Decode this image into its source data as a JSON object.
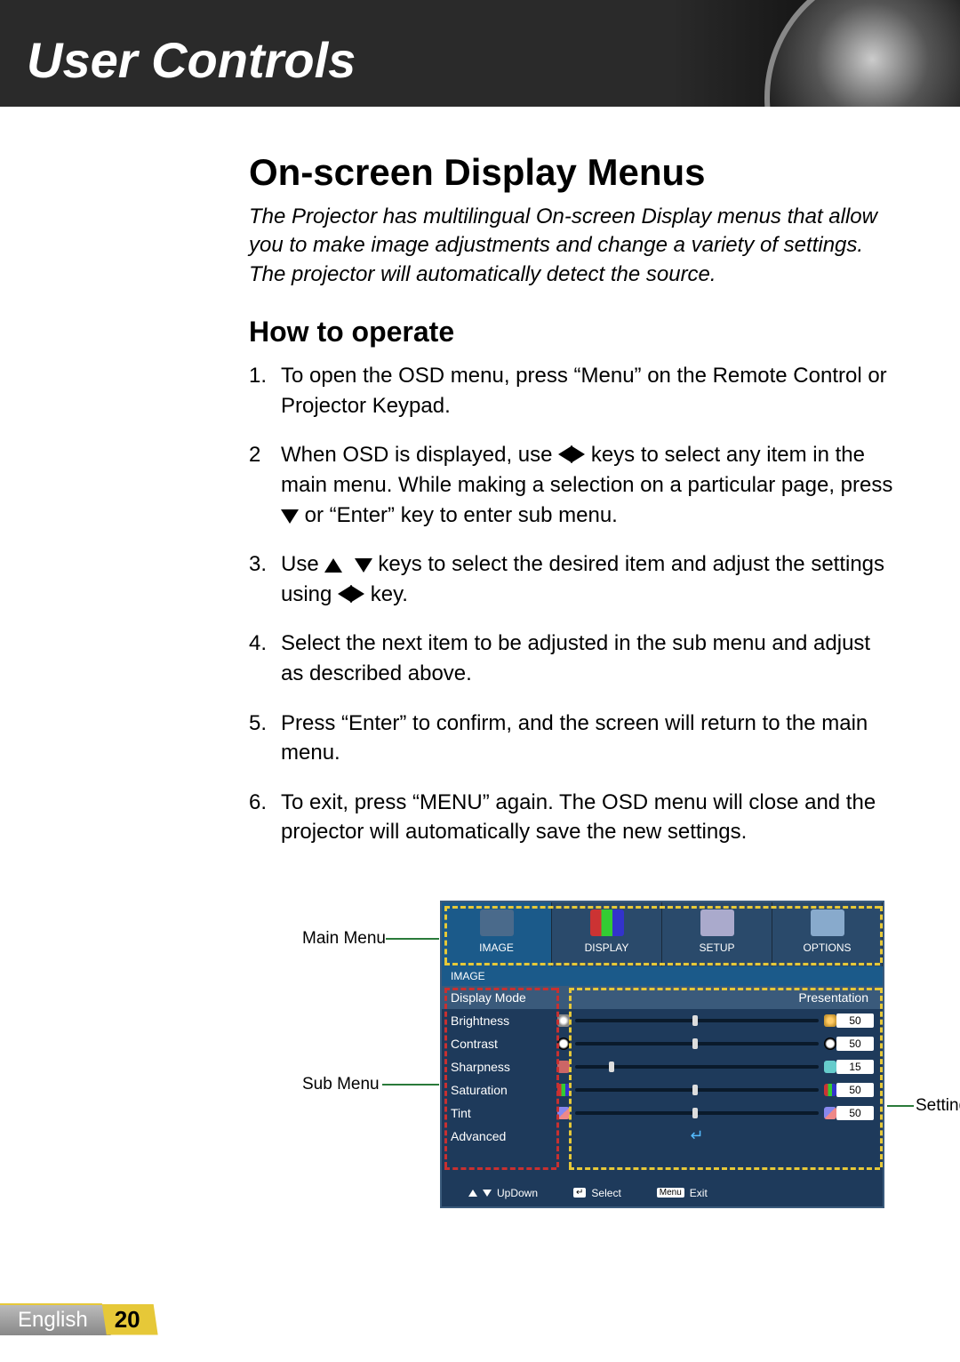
{
  "header": {
    "title": "User Controls"
  },
  "section": {
    "title": "On-screen Display Menus",
    "intro": "The Projector has multilingual On-screen Display menus that allow you to make image adjustments and change a variety of settings. The projector will automatically detect the source.",
    "subheading": "How to operate",
    "steps": {
      "s1": {
        "num": "1.",
        "text": "To open the OSD menu, press “Menu” on the Remote Control or Projector Keypad."
      },
      "s2": {
        "num": "2",
        "a": "When OSD is displayed, use ",
        "b": " keys to select any item in the main menu. While making a selection on a particular page, press ",
        "c": " or “Enter” key to enter sub menu."
      },
      "s3": {
        "num": "3.",
        "a": "Use ",
        "b": " keys to select the desired item and adjust the settings using ",
        "c": " key."
      },
      "s4": {
        "num": "4.",
        "text": "Select the next item to be adjusted in the sub menu and adjust as described above."
      },
      "s5": {
        "num": "5.",
        "text": "Press “Enter” to confirm, and the screen will return to the main menu."
      },
      "s6": {
        "num": "6.",
        "text": "To exit, press “MENU” again. The OSD menu will close and the projector will automatically save the new settings."
      }
    }
  },
  "figure": {
    "labels": {
      "main": "Main Menu",
      "sub": "Sub Menu",
      "settings": "Settings"
    },
    "tabs": [
      "IMAGE",
      "DISPLAY",
      "SETUP",
      "OPTIONS"
    ],
    "section_label": "IMAGE",
    "rows": {
      "display_mode": {
        "label": "Display Mode",
        "value": "Presentation"
      },
      "brightness": {
        "label": "Brightness",
        "value": "50"
      },
      "contrast": {
        "label": "Contrast",
        "value": "50"
      },
      "sharpness": {
        "label": "Sharpness",
        "value": "15"
      },
      "saturation": {
        "label": "Saturation",
        "value": "50"
      },
      "tint": {
        "label": "Tint",
        "value": "50"
      },
      "advanced": {
        "label": "Advanced"
      }
    },
    "footer": {
      "updown": "UpDown",
      "select": "Select",
      "menu": "Menu",
      "exit": "Exit"
    }
  },
  "footer": {
    "language": "English",
    "page": "20"
  }
}
